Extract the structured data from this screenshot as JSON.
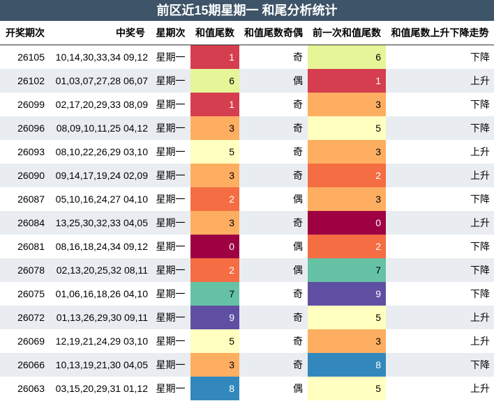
{
  "title": "前区近15期星期一 和尾分析统计",
  "headers": [
    "开奖期次",
    "中奖号",
    "星期次",
    "和值尾数",
    "和值尾数奇偶",
    "前一次和值尾数",
    "和值尾数上升下降走势"
  ],
  "digit_colors": {
    "0": "#9e0142",
    "1": "#d53e4f",
    "2": "#f46d43",
    "3": "#fdae61",
    "4": "#fee08b",
    "5": "#ffffbf",
    "6": "#e6f598",
    "7": "#66c2a5",
    "8": "#3288bd",
    "9": "#5e4fa2"
  },
  "rows": [
    {
      "issue": "26105",
      "numbers": "10,14,30,33,34 09,12",
      "weekday": "星期一",
      "tail": "1",
      "parity": "奇",
      "prev": "6",
      "trend": "下降"
    },
    {
      "issue": "26102",
      "numbers": "01,03,07,27,28 06,07",
      "weekday": "星期一",
      "tail": "6",
      "parity": "偶",
      "prev": "1",
      "trend": "上升"
    },
    {
      "issue": "26099",
      "numbers": "02,17,20,29,33 08,09",
      "weekday": "星期一",
      "tail": "1",
      "parity": "奇",
      "prev": "3",
      "trend": "下降"
    },
    {
      "issue": "26096",
      "numbers": "08,09,10,11,25 04,12",
      "weekday": "星期一",
      "tail": "3",
      "parity": "奇",
      "prev": "5",
      "trend": "下降"
    },
    {
      "issue": "26093",
      "numbers": "08,10,22,26,29 03,10",
      "weekday": "星期一",
      "tail": "5",
      "parity": "奇",
      "prev": "3",
      "trend": "上升"
    },
    {
      "issue": "26090",
      "numbers": "09,14,17,19,24 02,09",
      "weekday": "星期一",
      "tail": "3",
      "parity": "奇",
      "prev": "2",
      "trend": "上升"
    },
    {
      "issue": "26087",
      "numbers": "05,10,16,24,27 04,10",
      "weekday": "星期一",
      "tail": "2",
      "parity": "偶",
      "prev": "3",
      "trend": "下降"
    },
    {
      "issue": "26084",
      "numbers": "13,25,30,32,33 04,05",
      "weekday": "星期一",
      "tail": "3",
      "parity": "奇",
      "prev": "0",
      "trend": "上升"
    },
    {
      "issue": "26081",
      "numbers": "08,16,18,24,34 09,12",
      "weekday": "星期一",
      "tail": "0",
      "parity": "偶",
      "prev": "2",
      "trend": "下降"
    },
    {
      "issue": "26078",
      "numbers": "02,13,20,25,32 08,11",
      "weekday": "星期一",
      "tail": "2",
      "parity": "偶",
      "prev": "7",
      "trend": "下降"
    },
    {
      "issue": "26075",
      "numbers": "01,06,16,18,26 04,10",
      "weekday": "星期一",
      "tail": "7",
      "parity": "奇",
      "prev": "9",
      "trend": "下降"
    },
    {
      "issue": "26072",
      "numbers": "01,13,26,29,30 09,11",
      "weekday": "星期一",
      "tail": "9",
      "parity": "奇",
      "prev": "5",
      "trend": "上升"
    },
    {
      "issue": "26069",
      "numbers": "12,19,21,24,29 03,10",
      "weekday": "星期一",
      "tail": "5",
      "parity": "奇",
      "prev": "3",
      "trend": "上升"
    },
    {
      "issue": "26066",
      "numbers": "10,13,19,21,30 04,05",
      "weekday": "星期一",
      "tail": "3",
      "parity": "奇",
      "prev": "8",
      "trend": "下降"
    },
    {
      "issue": "26063",
      "numbers": "03,15,20,29,31 01,12",
      "weekday": "星期一",
      "tail": "8",
      "parity": "偶",
      "prev": "5",
      "trend": "上升"
    }
  ]
}
